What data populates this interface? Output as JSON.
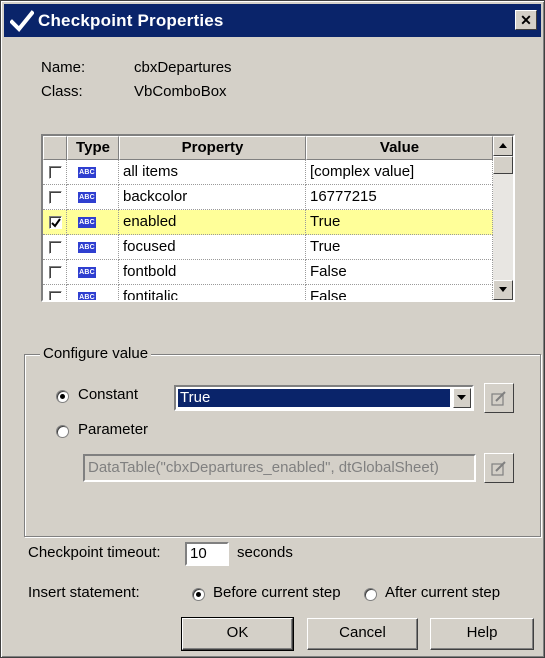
{
  "window": {
    "title": "Checkpoint Properties",
    "close_glyph": "✕"
  },
  "info": {
    "name_label": "Name:",
    "name_value": "cbxDepartures",
    "class_label": "Class:",
    "class_value": "VbComboBox"
  },
  "grid": {
    "columns": [
      "Type",
      "Property",
      "Value"
    ],
    "type_icon_text": "ABC",
    "rows": [
      {
        "checked": false,
        "property": "all items",
        "value": "[complex value]"
      },
      {
        "checked": false,
        "property": "backcolor",
        "value": "16777215"
      },
      {
        "checked": true,
        "property": "enabled",
        "value": "True"
      },
      {
        "checked": false,
        "property": "focused",
        "value": "True"
      },
      {
        "checked": false,
        "property": "fontbold",
        "value": "False"
      },
      {
        "checked": false,
        "property": "fontitalic",
        "value": "False"
      }
    ]
  },
  "configure": {
    "group_label": "Configure value",
    "constant_label": "Constant",
    "constant_value": "True",
    "parameter_label": "Parameter",
    "parameter_value": "DataTable(\"cbxDepartures_enabled\", dtGlobalSheet)",
    "selected": "constant"
  },
  "timeout": {
    "label": "Checkpoint timeout:",
    "value": "10",
    "unit": "seconds"
  },
  "insert": {
    "label": "Insert statement:",
    "before_label": "Before current step",
    "after_label": "After current step",
    "selected": "before"
  },
  "buttons": {
    "ok": "OK",
    "cancel": "Cancel",
    "help": "Help"
  },
  "colors": {
    "titlebar": "#0a246a",
    "selected_row": "#ffff99",
    "dialog_bg": "#d4d0c8",
    "type_icon": "#2f3fd0"
  }
}
